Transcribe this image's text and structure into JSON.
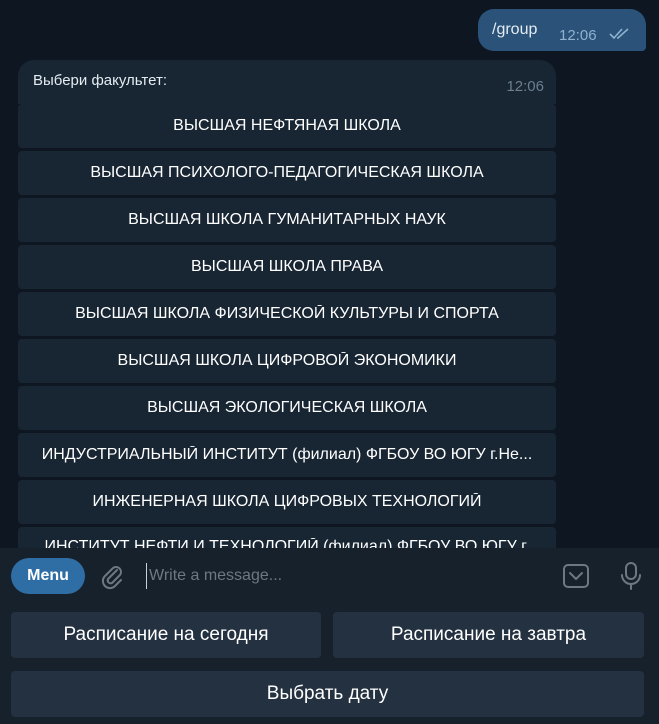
{
  "outgoing": {
    "text": "/group",
    "time": "12:06"
  },
  "incoming": {
    "text": "Выбери факультет:",
    "time": "12:06"
  },
  "inline_keyboard": [
    "ВЫСШАЯ НЕФТЯНАЯ ШКОЛА",
    "ВЫСШАЯ ПСИХОЛОГО-ПЕДАГОГИЧЕСКАЯ ШКОЛА",
    "ВЫСШАЯ ШКОЛА ГУМАНИТАРНЫХ НАУК",
    "ВЫСШАЯ ШКОЛА ПРАВА",
    "ВЫСШАЯ ШКОЛА ФИЗИЧЕСКОЙ КУЛЬТУРЫ И СПОРТА",
    "ВЫСШАЯ ШКОЛА ЦИФРОВОЙ ЭКОНОМИКИ",
    "ВЫСШАЯ ЭКОЛОГИЧЕСКАЯ ШКОЛА",
    "ИНДУСТРИАЛЬНЫЙ ИНСТИТУТ (филиал) ФГБОУ ВО ЮГУ г.Не...",
    "ИНЖЕНЕРНАЯ ШКОЛА ЦИФРОВЫХ ТЕХНОЛОГИЙ",
    "ИНСТИТУТ НЕФТИ И ТЕХНОЛОГИЙ (филиал) ФГБОУ ВО ЮГУ г."
  ],
  "composer": {
    "menu_label": "Menu",
    "placeholder": "Write a message...",
    "icons": [
      "attach-icon",
      "keyboard-toggle-icon",
      "microphone-icon"
    ]
  },
  "reply_keyboard": {
    "today": "Расписание на сегодня",
    "tomorrow": "Расписание на завтра",
    "pick_date": "Выбрать дату"
  },
  "colors": {
    "background": "#0e1621",
    "outgoing_bubble": "#2b5278",
    "incoming_bubble": "#182533",
    "menu_button": "#2f6ea5",
    "reply_button": "#243140"
  }
}
